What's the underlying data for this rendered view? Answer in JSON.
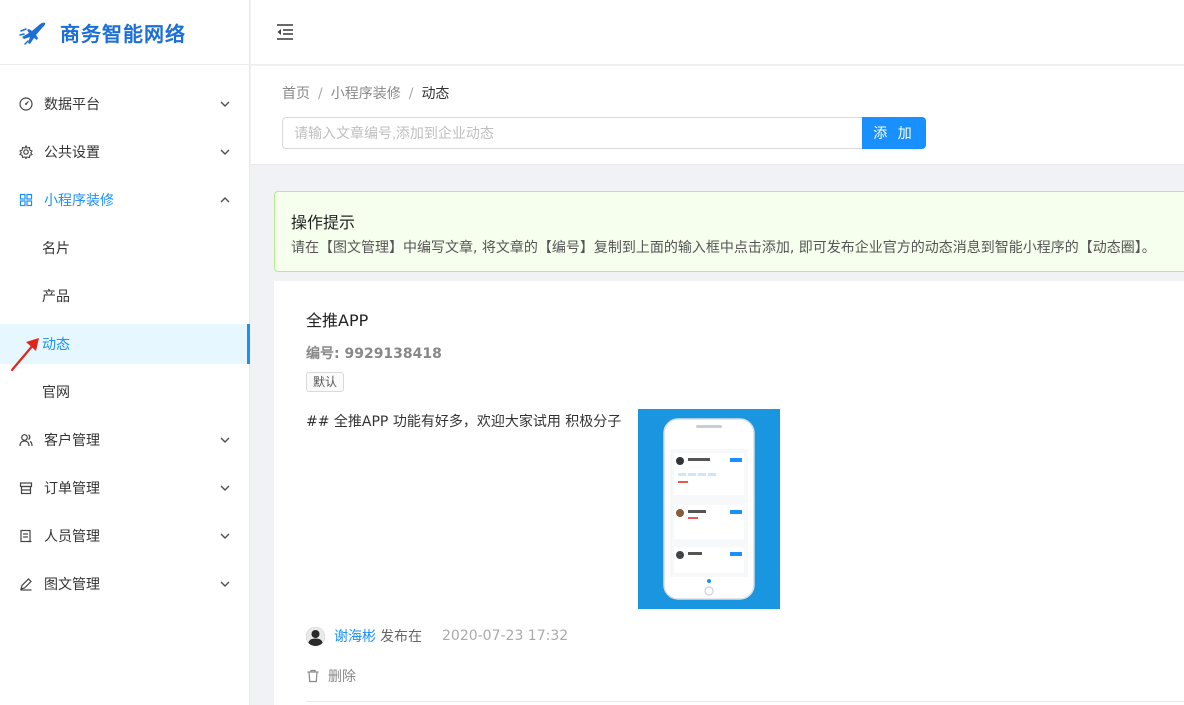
{
  "app": {
    "title": "商务智能网络",
    "accent": "#1890ff"
  },
  "sidebar": {
    "menu": [
      {
        "label": "数据平台",
        "icon": "dashboard-icon"
      },
      {
        "label": "公共设置",
        "icon": "gear-icon"
      },
      {
        "label": "小程序装修",
        "icon": "grid-icon",
        "open": true,
        "children": [
          {
            "label": "名片"
          },
          {
            "label": "产品"
          },
          {
            "label": "动态",
            "active": true
          },
          {
            "label": "官网"
          }
        ]
      },
      {
        "label": "客户管理",
        "icon": "users-icon"
      },
      {
        "label": "订单管理",
        "icon": "shop-icon"
      },
      {
        "label": "人员管理",
        "icon": "id-card-icon"
      },
      {
        "label": "图文管理",
        "icon": "pen-icon"
      }
    ]
  },
  "breadcrumb": {
    "home": "首页",
    "parent": "小程序装修",
    "current": "动态",
    "separator": "/"
  },
  "search": {
    "placeholder": "请输入文章编号,添加到企业动态",
    "value": "",
    "button": "添 加"
  },
  "tip": {
    "title": "操作提示",
    "description": "请在【图文管理】中编写文章, 将文章的【编号】复制到上面的输入框中点击添加, 即可发布企业官方的动态消息到智能小程序的【动态圈】。"
  },
  "post": {
    "title": "全推APP",
    "code": "编号: 9929138418",
    "tag": "默认",
    "body": "## 全推APP 功能有好多，欢迎大家试用 积极分子",
    "author": "谢海彬",
    "published_label": "发布在",
    "time": "2020-07-23 17:32",
    "delete_label": "删除"
  }
}
